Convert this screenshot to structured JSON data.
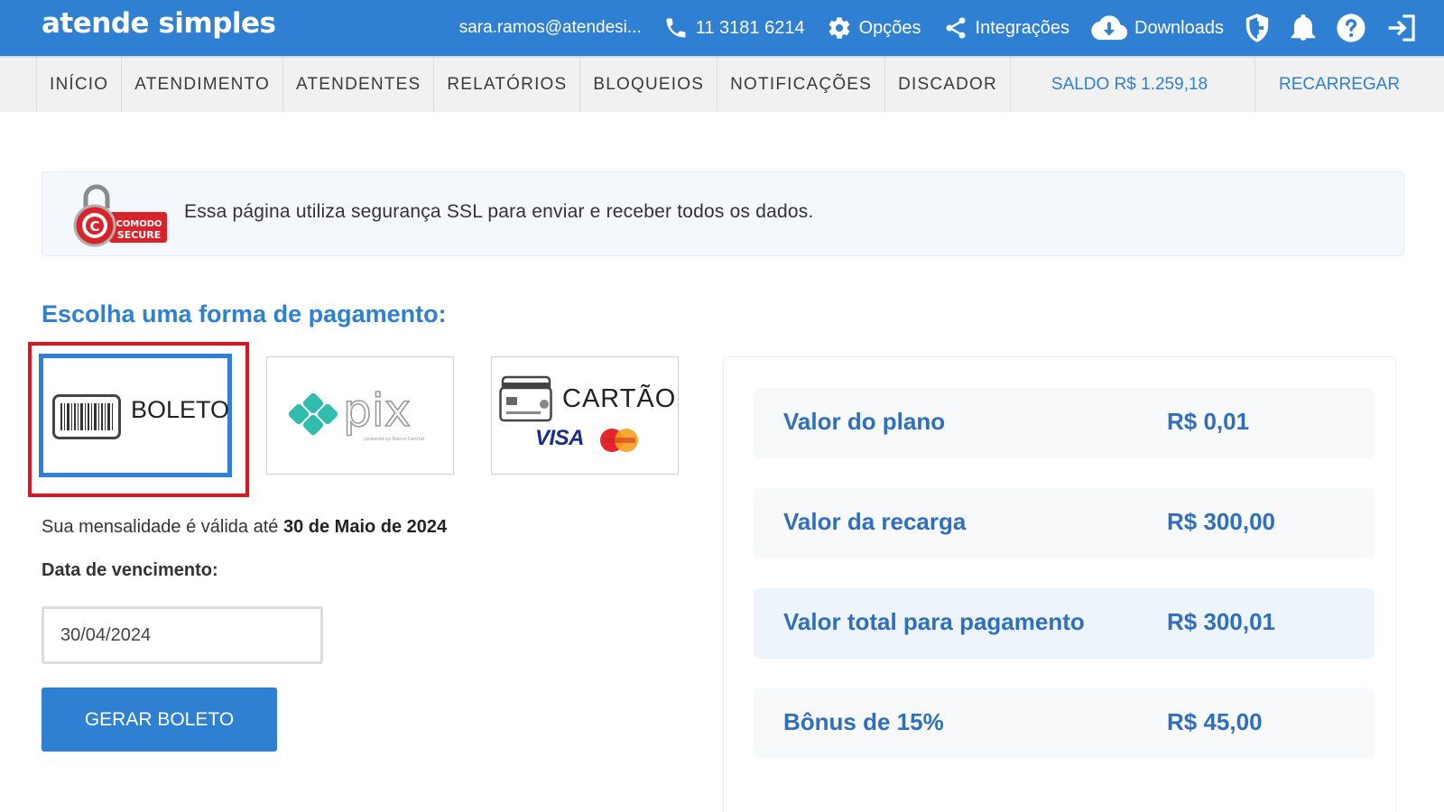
{
  "app": {
    "logo": "atende simples"
  },
  "topbar": {
    "email": "sara.ramos@atendesi...",
    "phone": "11 3181 6214",
    "options_label": "Opções",
    "integrations_label": "Integrações",
    "downloads_label": "Downloads"
  },
  "nav": {
    "items": [
      {
        "label": "INÍCIO"
      },
      {
        "label": "ATENDIMENTO"
      },
      {
        "label": "ATENDENTES"
      },
      {
        "label": "RELATÓRIOS"
      },
      {
        "label": "BLOQUEIOS"
      },
      {
        "label": "NOTIFICAÇÕES"
      },
      {
        "label": "DISCADOR"
      }
    ],
    "saldo": "SALDO R$ 1.259,18",
    "recarregar": "RECARREGAR"
  },
  "ssl": {
    "badge_text_1": "COMODO",
    "badge_text_2": "SECURE",
    "message": "Essa página utiliza segurança SSL para enviar e receber todos os dados."
  },
  "payment": {
    "title": "Escolha uma forma de pagamento:",
    "methods": [
      {
        "label": "BOLETO",
        "selected": true
      },
      {
        "label": "pix",
        "sub": "powered by Banco Central",
        "selected": false
      },
      {
        "label": "CARTÃO",
        "brand": "VISA",
        "selected": false
      }
    ],
    "validity_prefix": "Sua mensalidade é válida até ",
    "validity_date": "30 de Maio de 2024",
    "due_label": "Data de vencimento:",
    "due_value": "30/04/2024",
    "generate_button": "GERAR BOLETO"
  },
  "summary": {
    "rows": [
      {
        "label": "Valor do plano",
        "value": "R$ 0,01"
      },
      {
        "label": "Valor da recarga",
        "value": "R$ 300,00"
      },
      {
        "label": "Valor total para pagamento",
        "value": "R$ 300,01"
      },
      {
        "label": "Bônus de 15%",
        "value": "R$ 45,00"
      }
    ]
  },
  "colors": {
    "primary": "#2f7fd2",
    "highlight": "#e0141e",
    "pix_teal": "#32bcad"
  }
}
